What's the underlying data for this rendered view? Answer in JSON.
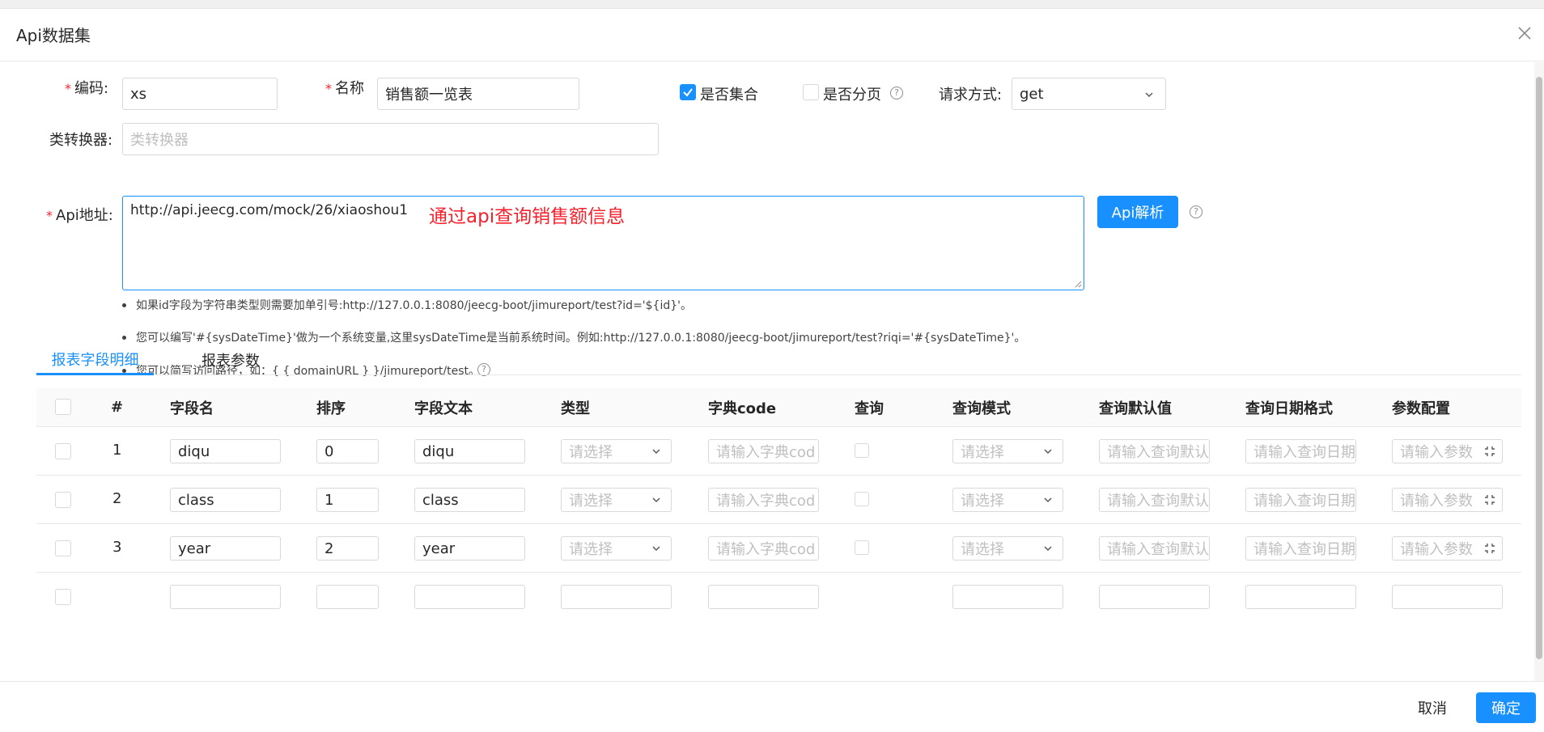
{
  "dialog": {
    "title": "Api数据集"
  },
  "form": {
    "code_label": "编码:",
    "code_value": "xs",
    "name_label": "名称",
    "name_value": "销售额一览表",
    "is_collection_label": "是否集合",
    "is_collection_checked": true,
    "is_paged_label": "是否分页",
    "is_paged_checked": false,
    "request_method_label": "请求方式:",
    "request_method_value": "get",
    "converter_label": "类转换器:",
    "converter_placeholder": "类转换器",
    "api_url_label": "Api地址:",
    "api_url_value": "http://api.jeecg.com/mock/26/xiaoshou1",
    "api_annotation": "通过api查询销售额信息",
    "api_parse_button": "Api解析"
  },
  "tips": [
    "如果id字段为字符串类型则需要加单引号:http://127.0.0.1:8080/jeecg-boot/jimureport/test?id='${id}'。",
    "您可以编写'#{sysDateTime}'做为一个系统变量,这里sysDateTime是当前系统时间。例如:http://127.0.0.1:8080/jeecg-boot/jimureport/test?riqi='#{sysDateTime}'。",
    "您可以简写访问路径，如：{ { domainURL } }/jimureport/test。"
  ],
  "tabs": [
    {
      "label": "报表字段明细",
      "active": true
    },
    {
      "label": "报表参数",
      "active": false
    }
  ],
  "table": {
    "headers": [
      "#",
      "字段名",
      "排序",
      "字段文本",
      "类型",
      "字典code",
      "查询",
      "查询模式",
      "查询默认值",
      "查询日期格式",
      "参数配置"
    ],
    "placeholders": {
      "type": "请选择",
      "dict_code": "请输入字典cod",
      "query_mode": "请选择",
      "query_default": "请输入查询默认",
      "date_format": "请输入查询日期",
      "param_config": "请输入参数"
    },
    "rows": [
      {
        "index": "1",
        "field_name": "diqu",
        "order": "0",
        "field_text": "diqu"
      },
      {
        "index": "2",
        "field_name": "class",
        "order": "1",
        "field_text": "class"
      },
      {
        "index": "3",
        "field_name": "year",
        "order": "2",
        "field_text": "year"
      }
    ]
  },
  "footer": {
    "cancel_label": "取消",
    "ok_label": "确定"
  },
  "colors": {
    "primary": "#1890ff",
    "required": "#f5222d",
    "annotation": "#f5222d"
  }
}
